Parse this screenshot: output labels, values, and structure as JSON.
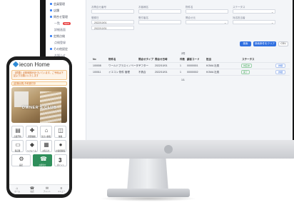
{
  "sidebar": {
    "items": [
      {
        "label": "会員管理",
        "sub": false
      },
      {
        "label": "店舗",
        "sub": false
      },
      {
        "label": "問合せ管理",
        "sub": false
      },
      {
        "label": "一覧",
        "sub": true,
        "badge": "NEW"
      },
      {
        "label": "詳細画面",
        "sub": true
      },
      {
        "label": "定期点検",
        "sub": false
      },
      {
        "label": "点検登録",
        "sub": true
      },
      {
        "label": "その他設定",
        "sub": false
      },
      {
        "label": "お知らせ",
        "sub": true
      }
    ]
  },
  "form": {
    "labels": [
      "お問合せ番号",
      "お客様名",
      "物件名",
      "ステータス",
      "登録日",
      "受付者名",
      "問合せ元",
      "対応担当者"
    ],
    "date_from": "2022/10/01",
    "date_to": "2022/10/31",
    "search_button": "検索",
    "clear_button": "検索条件をクリア",
    "csv_button": "CSV"
  },
  "table": {
    "count": "2件",
    "headers": [
      "No",
      "物件名",
      "問合せタイプ",
      "問合せ日時",
      "件数",
      "顧客コード",
      "担当",
      "ステータス",
      ""
    ],
    "rows": [
      {
        "no": "100008",
        "name": "ワールドプラスイノベーター",
        "type": "アフター",
        "date": "2022/10/01",
        "count": "1",
        "code": "00000001",
        "staff": "KOMA 社員",
        "status": "対応中",
        "action": "詳細"
      },
      {
        "no": "100011",
        "name": "イエコン 物件 管理",
        "type": "不具合",
        "date": "2022/10/01",
        "count": "1",
        "code": "00000002",
        "staff": "KOMA 社員",
        "status": "完了",
        "action": "詳細"
      }
    ],
    "footer": "1/1"
  },
  "phone": {
    "app_name": "iecon Home",
    "notice": "【重要】点検時期が近づいています。ご予約は下記よりお願いいたします",
    "notice2": "[定期点検] 予約受付中",
    "hero_title": "OWNER'S CLUB",
    "tiles": [
      {
        "icon": "clipboard-icon",
        "glyph": "📋",
        "label": "点検予約",
        "style": "normal"
      },
      {
        "icon": "tools-icon",
        "glyph": "🔧",
        "label": "修理依頼",
        "style": "normal"
      },
      {
        "icon": "house-icon",
        "glyph": "⌂",
        "label": "住まい情報",
        "style": "normal"
      },
      {
        "icon": "gift-icon",
        "glyph": "🎁",
        "label": "特典",
        "style": "normal"
      },
      {
        "icon": "document-icon",
        "glyph": "📄",
        "label": "保証書",
        "style": "normal"
      },
      {
        "icon": "shirt-icon",
        "glyph": "👕",
        "label": "リフォーム",
        "style": "normal"
      },
      {
        "icon": "calendar-icon",
        "glyph": "▦",
        "label": "お知らせ",
        "style": "normal"
      },
      {
        "icon": "person-icon",
        "glyph": "👤",
        "label": "お客様情報",
        "style": "normal"
      },
      {
        "icon": "tool-grid-icon",
        "glyph": "⚙",
        "label": "設定",
        "style": "normal"
      },
      {
        "icon": "phone-tile-icon",
        "glyph": "☎",
        "label": "お問合せ",
        "style": "green"
      },
      {
        "icon": "point-badge-icon",
        "glyph": "3",
        "label": "ポイント",
        "style": "normal"
      }
    ],
    "tabs": [
      {
        "icon": "home-tab-icon",
        "glyph": "⌂",
        "label": "ホーム"
      },
      {
        "icon": "phone-tab-icon",
        "glyph": "☎",
        "label": "電話"
      },
      {
        "icon": "chat-tab-icon",
        "glyph": "✉",
        "label": "チャット"
      },
      {
        "icon": "menu-tab-icon",
        "glyph": "≡",
        "label": "メニュー"
      }
    ]
  },
  "colors": {
    "accent": "#2f6fe0",
    "brand_green": "#2f8f5b",
    "notice_orange": "#d0651a"
  }
}
